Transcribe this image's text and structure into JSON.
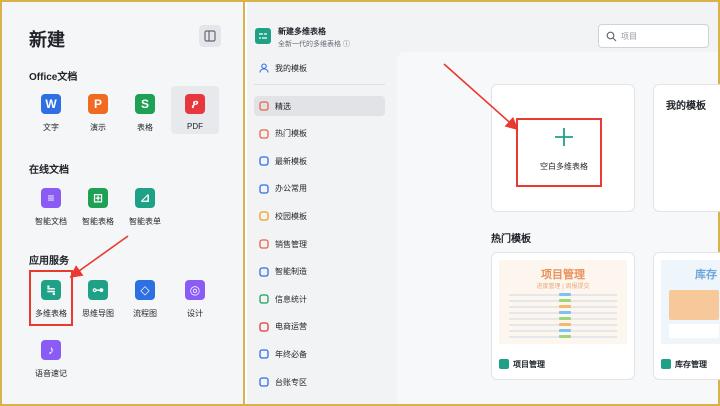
{
  "left_panel": {
    "title": "新建",
    "panel_toggle_icon": "sidebar-toggle-icon",
    "sections": [
      {
        "title": "Office文档",
        "items": [
          {
            "label": "文字",
            "icon": "word-icon",
            "glyph": "W",
            "color": "#2f6fe4"
          },
          {
            "label": "演示",
            "icon": "presentation-icon",
            "glyph": "P",
            "color": "#f06a22"
          },
          {
            "label": "表格",
            "icon": "spreadsheet-icon",
            "glyph": "S",
            "color": "#1fa155"
          },
          {
            "label": "PDF",
            "icon": "pdf-icon",
            "glyph": "ዖ",
            "color": "#e8363d"
          }
        ]
      },
      {
        "title": "在线文档",
        "items": [
          {
            "label": "智能文档",
            "icon": "smart-doc-icon",
            "glyph": "≡",
            "color": "#8a5cf5"
          },
          {
            "label": "智能表格",
            "icon": "smart-table-icon",
            "glyph": "⊞",
            "color": "#1fa155"
          },
          {
            "label": "智能表单",
            "icon": "smart-form-icon",
            "glyph": "⊿",
            "color": "#1fa187"
          }
        ]
      },
      {
        "title": "应用服务",
        "items": [
          {
            "label": "多维表格",
            "icon": "multidim-table-icon",
            "glyph": "≒",
            "color": "#1fa187"
          },
          {
            "label": "思维导图",
            "icon": "mindmap-icon",
            "glyph": "⊶",
            "color": "#1fa187"
          },
          {
            "label": "流程图",
            "icon": "flowchart-icon",
            "glyph": "◇",
            "color": "#2f6fe4"
          },
          {
            "label": "设计",
            "icon": "design-icon",
            "glyph": "◎",
            "color": "#8a5cf5"
          },
          {
            "label": "语音速记",
            "icon": "microphone-icon",
            "glyph": "♪",
            "color": "#8a5cf5"
          }
        ]
      }
    ]
  },
  "header": {
    "title": "新建多维表格",
    "subtitle": "全新一代的多维表格 ⓘ",
    "search_placeholder": "项目"
  },
  "nav": {
    "my_templates": "我的模板",
    "items": [
      {
        "label": "精选",
        "icon": "featured-icon",
        "color": "#e8634a",
        "active": true
      },
      {
        "label": "热门模板",
        "icon": "fire-icon",
        "color": "#e8634a"
      },
      {
        "label": "最新模板",
        "icon": "new-icon",
        "color": "#2f6fe4"
      },
      {
        "label": "办公常用",
        "icon": "office-icon",
        "color": "#2f6fe4"
      },
      {
        "label": "校园模板",
        "icon": "campus-icon",
        "color": "#f0a020"
      },
      {
        "label": "销售管理",
        "icon": "sales-icon",
        "color": "#e8634a"
      },
      {
        "label": "智能制造",
        "icon": "manufacturing-icon",
        "color": "#2f6fe4"
      },
      {
        "label": "信息统计",
        "icon": "statistics-icon",
        "color": "#1fa155"
      },
      {
        "label": "电商运营",
        "icon": "ecommerce-icon",
        "color": "#e8363d"
      },
      {
        "label": "年终必备",
        "icon": "year-end-icon",
        "color": "#2f6fe4"
      },
      {
        "label": "台账专区",
        "icon": "ledger-icon",
        "color": "#2f6fe4"
      }
    ]
  },
  "main": {
    "blank_card_label": "空白多维表格",
    "my_templates_card": "我的模板",
    "hot_section_title": "热门模板",
    "templates": [
      {
        "label": "项目管理",
        "preview_title": "项目管理",
        "preview_subtitle": "进度管理 | 周报提交"
      },
      {
        "label": "库存管理",
        "preview_title": "库存",
        "preview_subtitle": ""
      }
    ]
  },
  "colors": {
    "accent_red": "#e83a30",
    "brand_green": "#1fa187",
    "frame_gold": "#d9b24c"
  }
}
